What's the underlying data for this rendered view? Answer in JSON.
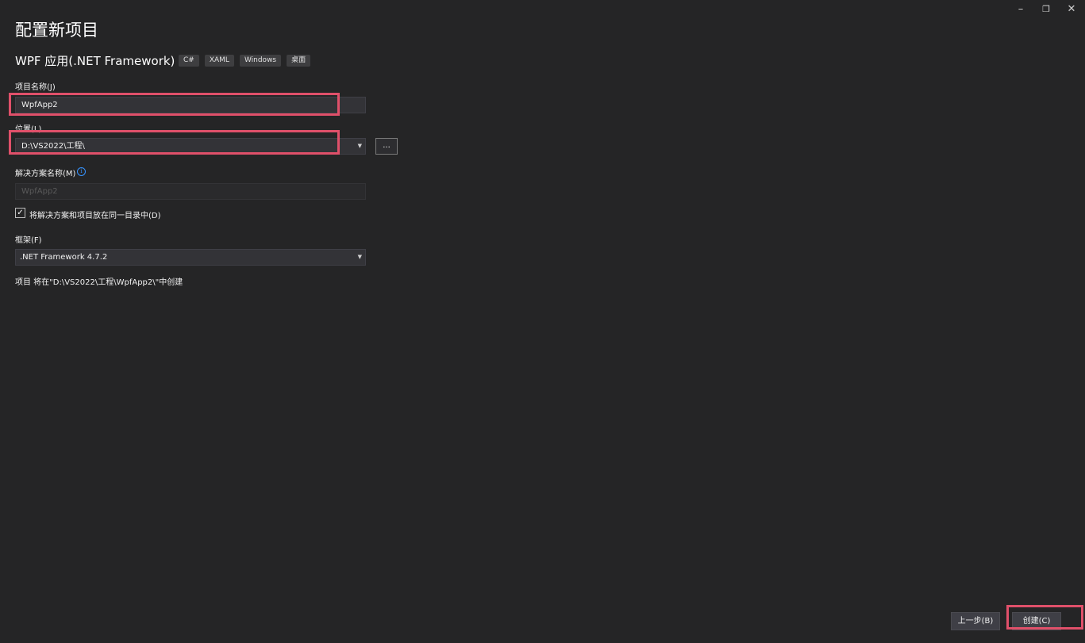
{
  "window_controls": {
    "minimize": "–",
    "restore": "❐",
    "close": "✕"
  },
  "page_title": "配置新项目",
  "template": {
    "name": "WPF 应用(.NET Framework)",
    "tags": [
      "C#",
      "XAML",
      "Windows",
      "桌面"
    ]
  },
  "project_name": {
    "label": "项目名称(J)",
    "value": "WpfApp2"
  },
  "location": {
    "label": "位置(L)",
    "value": "D:\\VS2022\\工程\\",
    "browse_label": "..."
  },
  "solution_name": {
    "label": "解决方案名称(M)",
    "placeholder": "WpfApp2",
    "info_icon": "i"
  },
  "same_directory": {
    "label": "将解决方案和项目放在同一目录中(D)",
    "checked": true,
    "check_mark": "✓"
  },
  "framework": {
    "label": "框架(F)",
    "value": ".NET Framework 4.7.2"
  },
  "dropdown_arrow": "▼",
  "summary_text": "项目 将在\"D:\\VS2022\\工程\\WpfApp2\\\"中创建",
  "footer": {
    "back_label": "上一步(B)",
    "create_label": "创建(C)"
  },
  "colors": {
    "background": "#252526",
    "highlight": "#e0506a",
    "info": "#3794ff"
  }
}
